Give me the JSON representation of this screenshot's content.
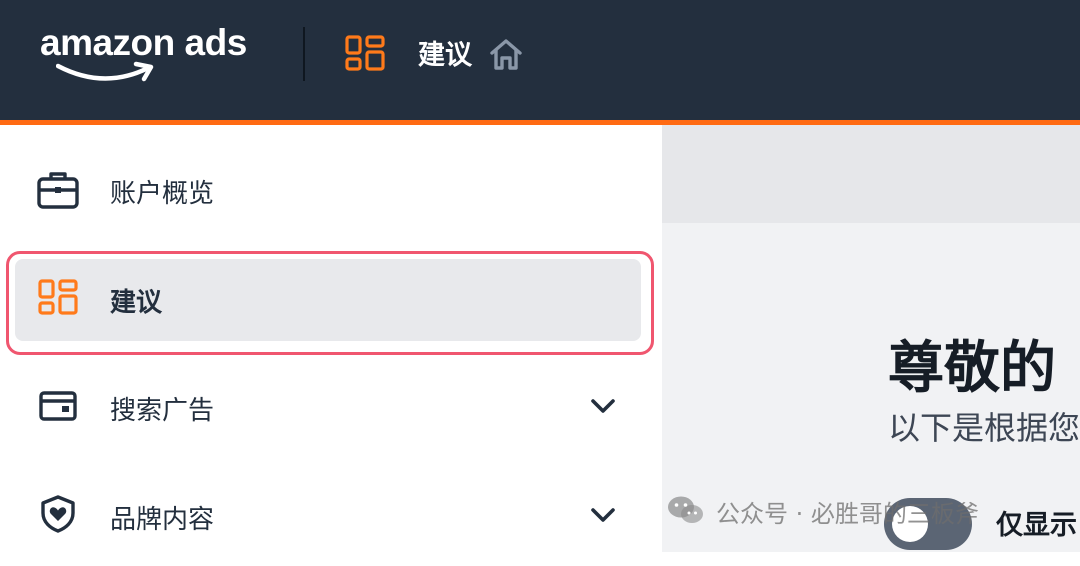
{
  "header": {
    "logo_text": "amazon ads",
    "title": "建议",
    "app_icon": "grid-icon",
    "home_icon": "home-icon"
  },
  "sidebar": {
    "items": [
      {
        "label": "账户概览",
        "icon": "briefcase-icon",
        "active": false,
        "expandable": false
      },
      {
        "label": "建议",
        "icon": "grid-icon",
        "active": true,
        "expandable": false
      },
      {
        "label": "搜索广告",
        "icon": "wallet-icon",
        "active": false,
        "expandable": true
      },
      {
        "label": "品牌内容",
        "icon": "shield-heart-icon",
        "active": false,
        "expandable": true
      }
    ]
  },
  "main": {
    "greeting": "尊敬的",
    "subtitle": "以下是根据您",
    "toggle_label": "仅显示"
  },
  "watermark": {
    "text": "公众号 · 必胜哥的三板斧"
  },
  "colors": {
    "header_bg": "#232f3e",
    "accent_orange": "#ff6a13",
    "highlight_border": "#f0566f",
    "active_item_bg": "#e8e9ec"
  }
}
